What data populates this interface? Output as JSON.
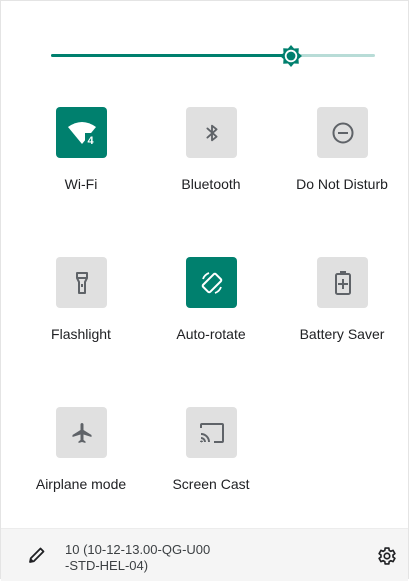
{
  "brightness": {
    "level_percent": 74
  },
  "tiles": [
    {
      "label": "Wi-Fi",
      "active": true,
      "icon": "wifi-icon",
      "badge": "4"
    },
    {
      "label": "Bluetooth",
      "active": false,
      "icon": "bluetooth-icon"
    },
    {
      "label": "Do Not Disturb",
      "active": false,
      "icon": "do-not-disturb-icon"
    },
    {
      "label": "Flashlight",
      "active": false,
      "icon": "flashlight-icon"
    },
    {
      "label": "Auto-rotate",
      "active": true,
      "icon": "auto-rotate-icon"
    },
    {
      "label": "Battery Saver",
      "active": false,
      "icon": "battery-saver-icon"
    },
    {
      "label": "Airplane mode",
      "active": false,
      "icon": "airplane-icon"
    },
    {
      "label": "Screen Cast",
      "active": false,
      "icon": "screen-cast-icon"
    }
  ],
  "footer": {
    "build_line1": "10 (10-12-13.00-QG-U00",
    "build_line2": "-STD-HEL-04)",
    "edit_icon": "pencil-icon",
    "settings_icon": "gear-icon"
  },
  "colors": {
    "accent": "#00806e",
    "accent_light": "#b8dcd7",
    "tile_inactive": "#e0e0e0",
    "icon_inactive": "#5f6368"
  }
}
